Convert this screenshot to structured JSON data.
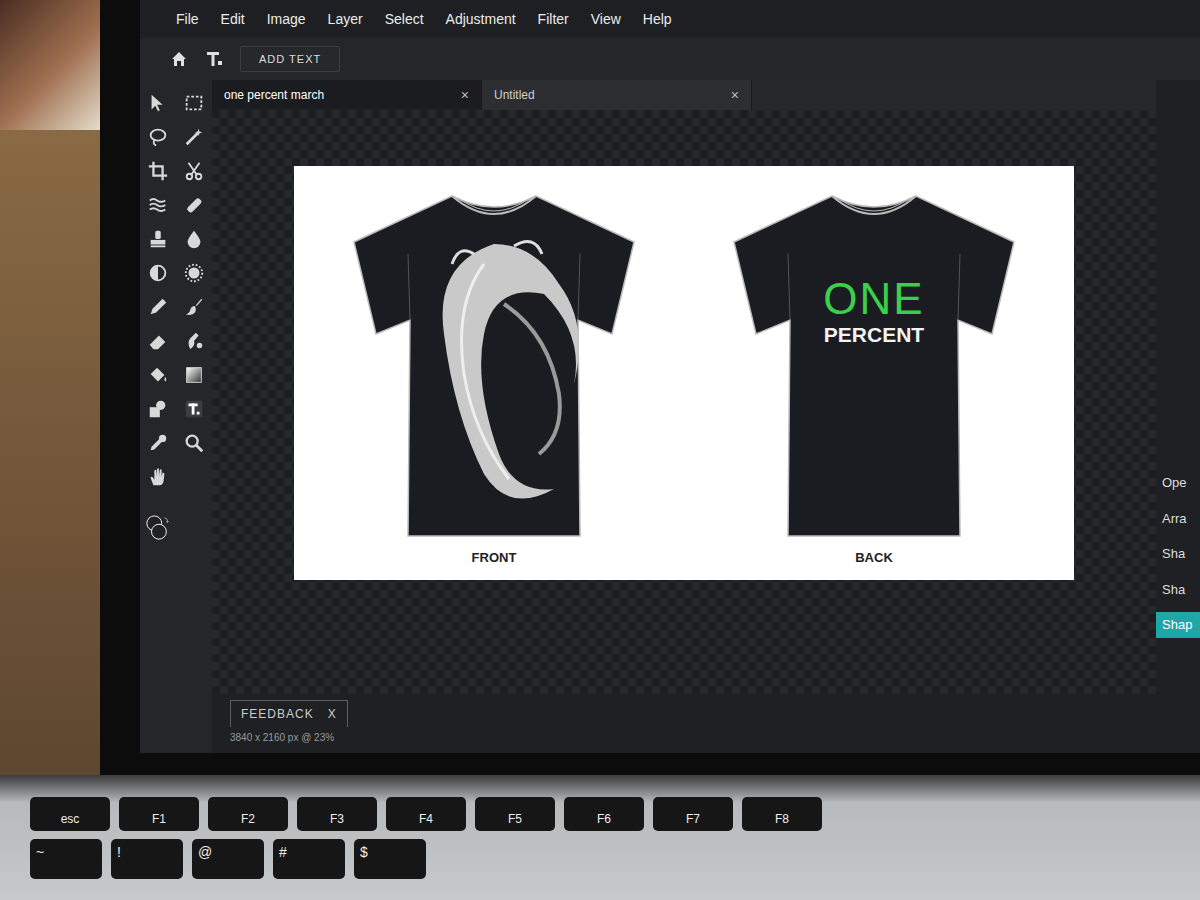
{
  "menu": [
    "File",
    "Edit",
    "Image",
    "Layer",
    "Select",
    "Adjustment",
    "Filter",
    "View",
    "Help"
  ],
  "add_text_button": "ADD TEXT",
  "tabs": [
    {
      "label": "one percent march",
      "close": "×",
      "selected": true
    },
    {
      "label": "Untitled",
      "close": "×",
      "selected": false
    }
  ],
  "document": {
    "front_label": "FRONT",
    "back_label": "BACK",
    "logo_top": "ONE",
    "logo_bottom": "PERCENT"
  },
  "feedback": {
    "label": "FEEDBACK",
    "close": "X"
  },
  "status": "3840 x 2160 px @ 23%",
  "right_panel": [
    {
      "label": "Ope",
      "selected": false
    },
    {
      "label": "Arra",
      "selected": false
    },
    {
      "label": "Sha",
      "selected": false
    },
    {
      "label": "Sha",
      "selected": false
    },
    {
      "label": "Shap",
      "selected": true
    }
  ],
  "keyboard": {
    "function_row": [
      "esc",
      "F1",
      "F2",
      "F3",
      "F4",
      "F5",
      "F6",
      "F7",
      "F8"
    ],
    "number_row": [
      "~",
      "!",
      "@",
      "#",
      "$"
    ]
  }
}
